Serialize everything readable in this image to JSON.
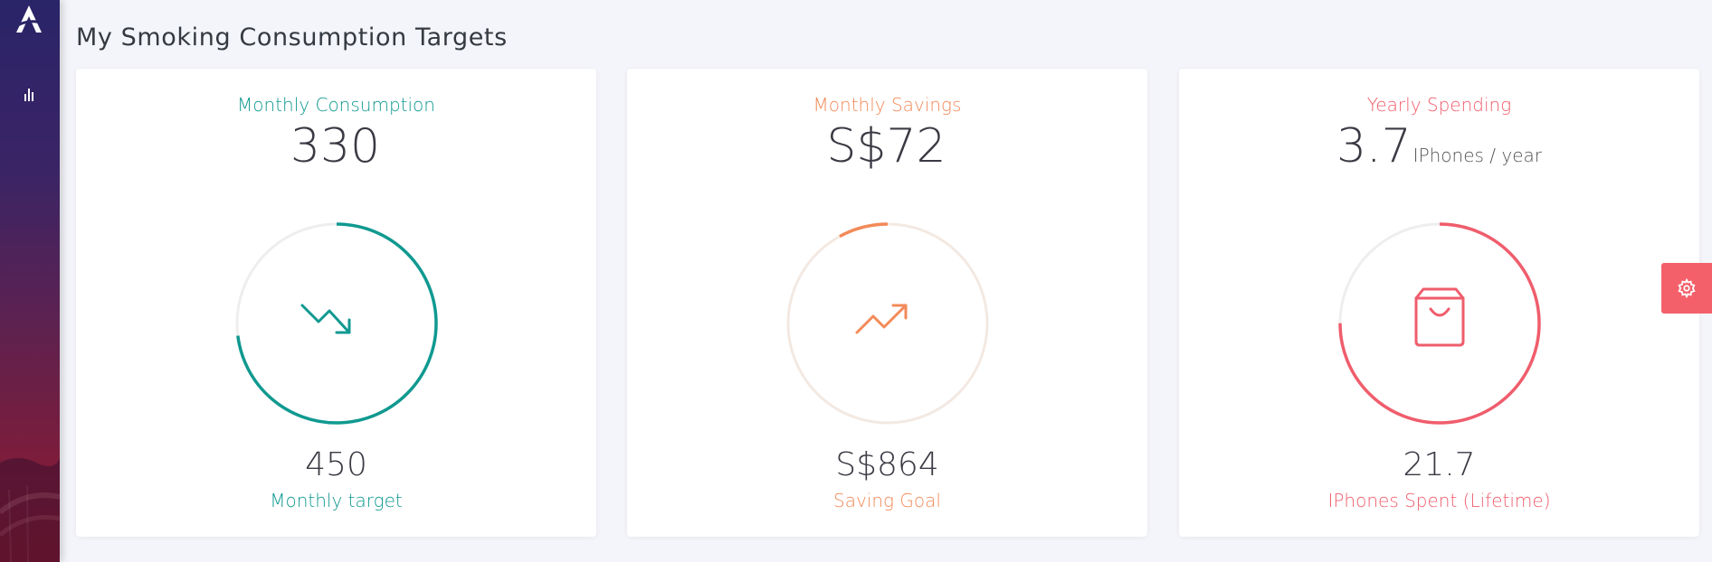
{
  "page": {
    "title": "My Smoking Consumption Targets"
  },
  "colors": {
    "teal": "#109990",
    "orange": "#f28a59",
    "red": "#ef5d6c",
    "track": "#eeeeee"
  },
  "cards": [
    {
      "label": "Monthly Consumption",
      "value": "330",
      "unit": "",
      "icon": "trending-down-icon",
      "progress": 0.73,
      "footer_value": "450",
      "footer_label": "Monthly target"
    },
    {
      "label": "Monthly Savings",
      "value": "S$72",
      "unit": "",
      "icon": "trending-up-icon",
      "progress": 0.08,
      "footer_value": "S$864",
      "footer_label": "Saving Goal"
    },
    {
      "label": "Yearly Spending",
      "value": "3.7",
      "unit": "IPhones / year",
      "icon": "shopping-bag-icon",
      "progress": 0.75,
      "footer_value": "21.7",
      "footer_label": "IPhones Spent (Lifetime)"
    }
  ],
  "sidebar": {
    "items": [
      {
        "icon": "bar-chart-icon"
      }
    ],
    "logo": "brand-logo"
  },
  "settings": {
    "icon": "gear-icon"
  }
}
